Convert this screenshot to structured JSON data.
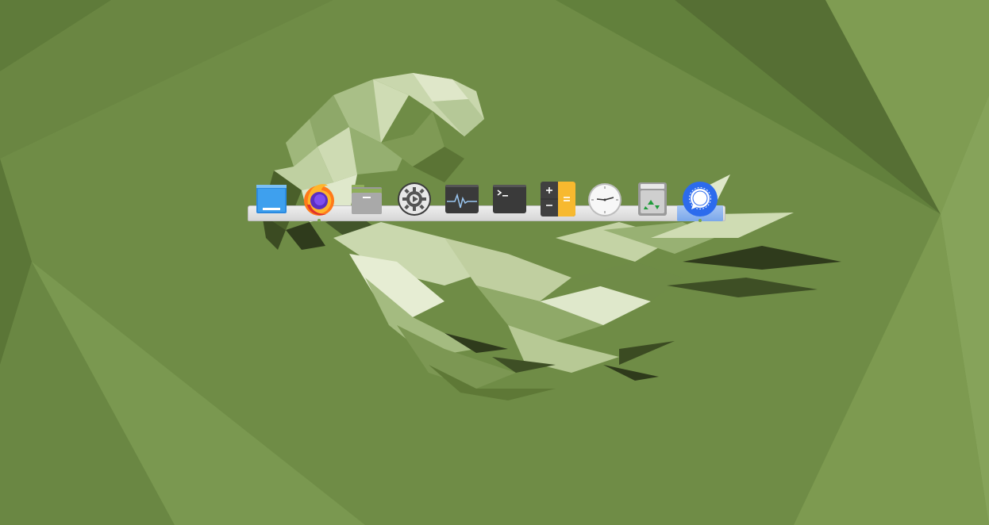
{
  "desktop": {
    "wallpaper": {
      "base_color": "#6e8b45",
      "accent_light": "#dfe7c9",
      "accent_dark": "#2f3a1c"
    }
  },
  "dock": {
    "items": [
      {
        "id": "show-desktop",
        "icon": "show-desktop-icon",
        "running": false,
        "active": false
      },
      {
        "id": "firefox",
        "icon": "firefox-icon",
        "running": true,
        "active": false
      },
      {
        "id": "files",
        "icon": "folder-icon",
        "running": false,
        "active": false
      },
      {
        "id": "settings",
        "icon": "gear-icon",
        "running": false,
        "active": false
      },
      {
        "id": "system-monitor",
        "icon": "system-monitor-icon",
        "running": false,
        "active": false
      },
      {
        "id": "terminal",
        "icon": "terminal-icon",
        "running": false,
        "active": false
      },
      {
        "id": "calculator",
        "icon": "calculator-icon",
        "running": false,
        "active": false
      },
      {
        "id": "clock",
        "icon": "clock-icon",
        "running": false,
        "active": false
      },
      {
        "id": "trash",
        "icon": "trash-icon",
        "running": false,
        "active": false
      },
      {
        "id": "signal",
        "icon": "signal-messenger-icon",
        "running": true,
        "active": true
      }
    ]
  }
}
